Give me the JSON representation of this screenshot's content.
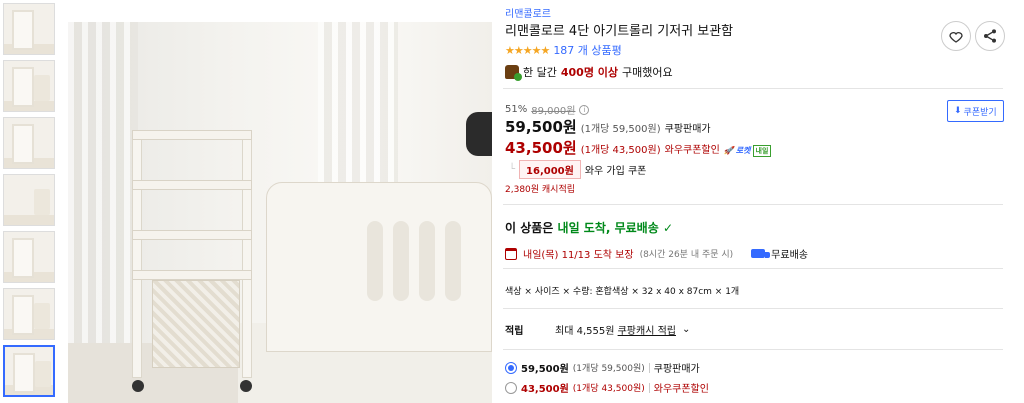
{
  "thumbnails": [
    "thumb-1",
    "thumb-2",
    "thumb-3",
    "thumb-4",
    "thumb-5",
    "thumb-6",
    "thumb-7"
  ],
  "product": {
    "brand": "리맨콜로르",
    "title": "리맨콜로르 4단 아기트롤리 기저귀 보관함",
    "stars": "★★★★★",
    "rating_value": 4.5,
    "review_count": "187 개 상품평",
    "bought_prefix": "한 달간",
    "bought_highlight": "400명 이상",
    "bought_suffix": "구매했어요"
  },
  "pricing": {
    "discount_rate": "51%",
    "original_price": "89,000원",
    "coupon_button": "쿠폰받기",
    "sale_price": "59,500원",
    "sale_unit": "(1개당 59,500원)",
    "sale_label": "쿠팡판매가",
    "wow_price": "43,500원",
    "wow_unit": "(1개당 43,500원)",
    "wow_label": "와우쿠폰할인",
    "rocket_label": "로켓",
    "rocket_day": "내일",
    "wow_coupon_amount": "16,000원",
    "wow_coupon_text": "와우 가입 쿠폰",
    "cash_reward": "2,380원 캐시적립"
  },
  "delivery": {
    "arrival_prefix": "이 상품은",
    "arrival_highlight": "내일 도착, 무료배송",
    "check": "✓",
    "date": "내일(목) 11/13 도착 보장",
    "cutoff": "(8시간 26분 내 주문 시)",
    "free_shipping": "무료배송"
  },
  "options_text": "색상 × 사이즈 × 수량: 혼합색상 × 32 x 40 x 87cm × 1개",
  "reward": {
    "label": "적립",
    "max": "최대 4,555원",
    "link": "쿠팡캐시 적립"
  },
  "price_options": [
    {
      "price": "59,500원",
      "unit": "(1개당 59,500원)",
      "label": "쿠팡판매가",
      "selected": true
    },
    {
      "price": "43,500원",
      "unit": "(1개당 43,500원)",
      "label": "와우쿠폰할인",
      "selected": false
    }
  ],
  "colors": {
    "accent": "#346aff",
    "price_red": "#ae0000",
    "delivery_green": "#00891a"
  }
}
